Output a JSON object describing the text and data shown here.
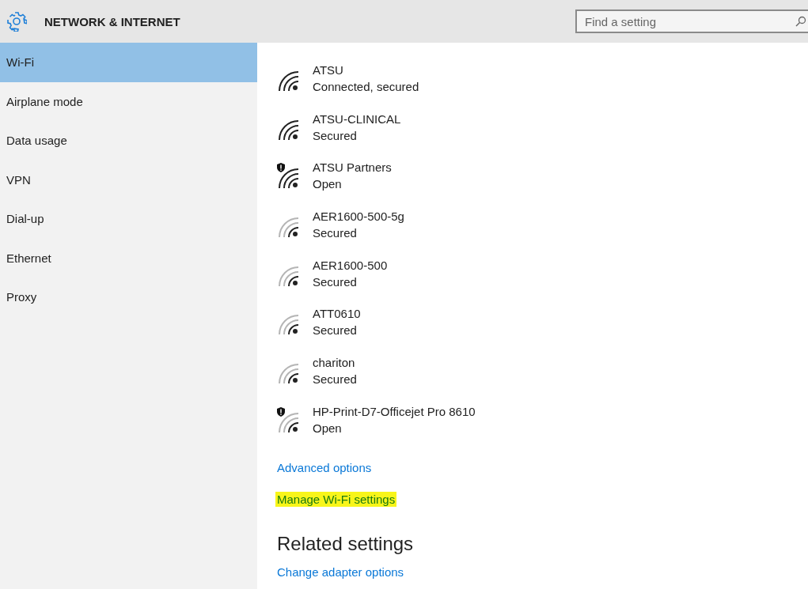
{
  "header": {
    "title": "NETWORK & INTERNET",
    "search": {
      "placeholder": "Find a setting"
    }
  },
  "sidebar": {
    "items": [
      {
        "label": "Wi-Fi",
        "selected": true
      },
      {
        "label": "Airplane mode",
        "selected": false
      },
      {
        "label": "Data usage",
        "selected": false
      },
      {
        "label": "VPN",
        "selected": false
      },
      {
        "label": "Dial-up",
        "selected": false
      },
      {
        "label": "Ethernet",
        "selected": false
      },
      {
        "label": "Proxy",
        "selected": false
      }
    ]
  },
  "networks": [
    {
      "name": "ATSU",
      "status": "Connected, secured",
      "full_signal": true,
      "shield": false
    },
    {
      "name": "ATSU-CLINICAL",
      "status": "Secured",
      "full_signal": true,
      "shield": false
    },
    {
      "name": "ATSU Partners",
      "status": "Open",
      "full_signal": true,
      "shield": true
    },
    {
      "name": "AER1600-500-5g",
      "status": "Secured",
      "full_signal": false,
      "shield": false
    },
    {
      "name": "AER1600-500",
      "status": "Secured",
      "full_signal": false,
      "shield": false
    },
    {
      "name": "ATT0610",
      "status": "Secured",
      "full_signal": false,
      "shield": false
    },
    {
      "name": "chariton",
      "status": "Secured",
      "full_signal": false,
      "shield": false
    },
    {
      "name": "HP-Print-D7-Officejet Pro 8610",
      "status": "Open",
      "full_signal": false,
      "shield": true
    }
  ],
  "links": [
    {
      "label": "Advanced options",
      "highlighted": false
    },
    {
      "label": "Manage Wi-Fi settings",
      "highlighted": true
    }
  ],
  "related": {
    "heading": "Related settings",
    "links": [
      "Change adapter options"
    ]
  }
}
